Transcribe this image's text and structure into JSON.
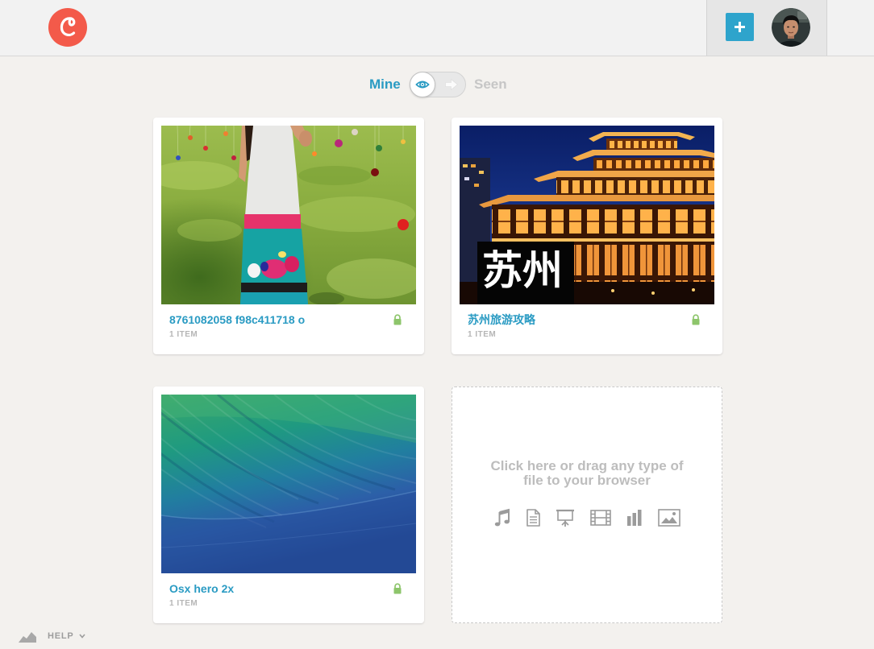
{
  "app": {
    "logo_icon": "logo-icon",
    "brand_color": "#f35a4a"
  },
  "header": {
    "add_icon": "plus-icon",
    "add_button_color": "#2ea4cc",
    "avatar_icon": "user-avatar"
  },
  "view_toggle": {
    "mine_label": "Mine",
    "seen_label": "Seen",
    "knob_icon": "eye-icon",
    "seen_icon": "arrow-right-icon"
  },
  "collections": [
    {
      "title": "8761082058 f98c411718 o",
      "count": "1 ITEM",
      "lock_icon": "lock-icon"
    },
    {
      "title": "苏州旅游攻略",
      "count": "1 ITEM",
      "lock_icon": "lock-icon",
      "overlay_text": "苏州"
    },
    {
      "title": "Osx hero 2x",
      "count": "1 ITEM",
      "lock_icon": "lock-icon"
    }
  ],
  "dropzone": {
    "message": "Click here or drag any type of file to your browser",
    "file_type_icons": [
      "music-icon",
      "document-icon",
      "presentation-icon",
      "film-icon",
      "bar-chart-icon",
      "image-icon"
    ]
  },
  "footer": {
    "stats_icon": "area-chart-icon",
    "help_label": "HELP",
    "help_icon": "chevron-down-icon"
  },
  "colors": {
    "accent": "#2a9bc3",
    "lock": "#8dc56b",
    "muted_text": "#b6b6b6",
    "page_background": "#f3f1ee",
    "header_background": "#f2f2f2"
  }
}
